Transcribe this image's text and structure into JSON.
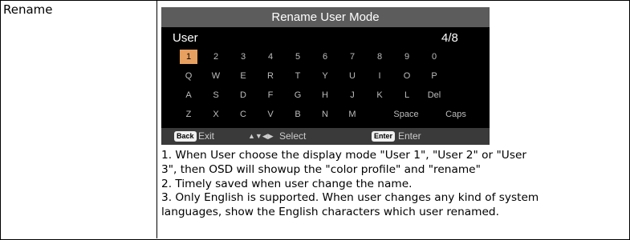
{
  "row_label": "Rename",
  "osd": {
    "title": "Rename User Mode",
    "name_value": "User",
    "char_count": "4/8",
    "keys": [
      [
        "1",
        "2",
        "3",
        "4",
        "5",
        "6",
        "7",
        "8",
        "9",
        "0"
      ],
      [
        "Q",
        "W",
        "E",
        "R",
        "T",
        "Y",
        "U",
        "I",
        "O",
        "P"
      ],
      [
        "A",
        "S",
        "D",
        "F",
        "G",
        "H",
        "J",
        "K",
        "L",
        "Del"
      ],
      [
        "Z",
        "X",
        "C",
        "V",
        "B",
        "N",
        "M",
        "Space",
        "Caps"
      ]
    ],
    "selected_key": "1",
    "footer": {
      "back_badge": "Back",
      "back_label": "Exit",
      "arrows": "▲▼◀▶",
      "select_label": "Select",
      "enter_badge": "Enter",
      "enter_label": "Enter"
    }
  },
  "notes": [
    "1. When User choose the display mode \"User 1\", \"User 2\" or \"User",
    "3\", then OSD will showup the \"color profile\" and \"rename\"",
    "2. Timely saved when user change the name.",
    "3. Only English is supported. When user changes any kind of system",
    "languages, show the English characters which user renamed."
  ]
}
